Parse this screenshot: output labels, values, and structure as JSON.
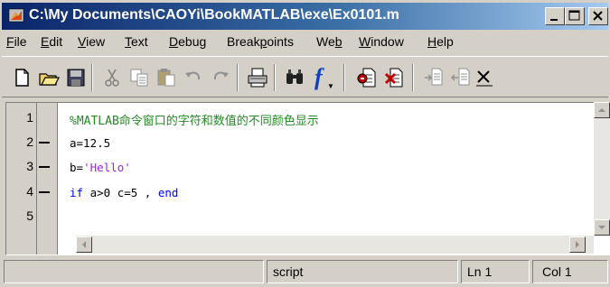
{
  "window": {
    "title": "C:\\My Documents\\CAOYi\\BookMATLAB\\exe\\Ex0101.m",
    "icons": [
      "matlab-app-icon",
      "minimize-icon",
      "maximize-icon",
      "close-icon"
    ]
  },
  "menu": {
    "items": [
      "File",
      "Edit",
      "View",
      "Text",
      "Debug",
      "Breakpoints",
      "Web",
      "Window",
      "Help"
    ]
  },
  "toolbar": {
    "icons": [
      "new-file-icon",
      "open-file-icon",
      "save-icon",
      "cut-icon",
      "copy-icon",
      "paste-icon",
      "undo-icon",
      "redo-icon",
      "print-icon",
      "find-icon",
      "function-icon",
      "set-breakpoint-icon",
      "clear-breakpoint-icon",
      "step-in-icon",
      "step-out-icon",
      "close-partial-icon"
    ],
    "function_glyph": "f"
  },
  "editor": {
    "lines": [
      {
        "number": "1",
        "mark": false,
        "text": "%MATLAB命令窗口的字符和数值的不同颜色显示",
        "kind": "comment"
      },
      {
        "number": "2",
        "mark": true,
        "text": "a=12.5",
        "kind": "default"
      },
      {
        "number": "3",
        "mark": true,
        "text_prefix": "b=",
        "text_string": "'Hello'",
        "kind": "mixed"
      },
      {
        "number": "4",
        "mark": true,
        "kw1": "if",
        "mid": " a>0 c=5 ,",
        "kw2": "end",
        "kind": "keyword"
      },
      {
        "number": "5",
        "mark": false,
        "text": "",
        "kind": "default"
      }
    ],
    "colors": {
      "comment": "#228b22",
      "string": "#a020f0",
      "keyword": "#0000ff",
      "default": "#000000"
    }
  },
  "status": {
    "mode": "script",
    "line": "Ln 1",
    "col": "Col 1"
  }
}
